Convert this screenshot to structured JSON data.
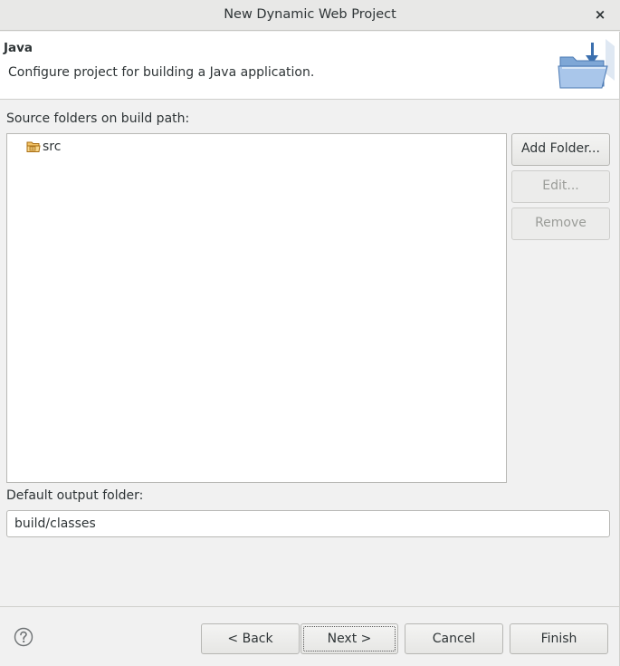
{
  "window": {
    "title": "New Dynamic Web Project",
    "close_glyph": "×"
  },
  "header": {
    "heading": "Java",
    "description": "Configure project for building a Java application.",
    "icon": "java-wizard-folder-icon"
  },
  "source_folders": {
    "label": "Source folders on build path:",
    "items": [
      {
        "name": "src",
        "icon": "source-folder-icon"
      }
    ],
    "buttons": {
      "add": "Add Folder...",
      "edit": "Edit...",
      "remove": "Remove"
    }
  },
  "output": {
    "label": "Default output folder:",
    "value": "build/classes"
  },
  "footer": {
    "help_icon": "help-icon",
    "back": "< Back",
    "next": "Next >",
    "cancel": "Cancel",
    "finish": "Finish"
  },
  "colors": {
    "background": "#f1f1f1",
    "header_bg": "#ffffff",
    "text": "#2e3436",
    "disabled_text": "#9a9c98",
    "folder": "#e8a83a"
  }
}
